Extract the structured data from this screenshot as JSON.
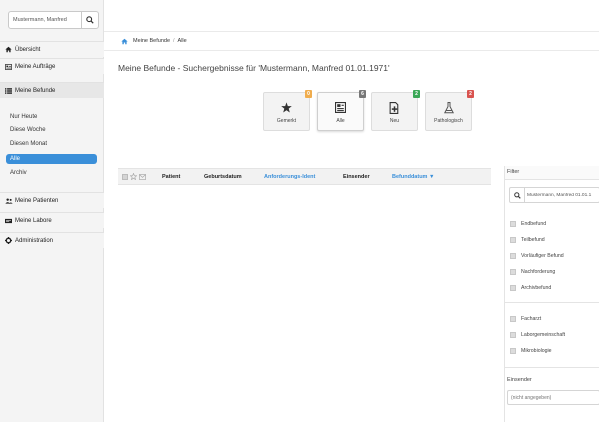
{
  "sidebar": {
    "search": {
      "value": "Mustermann, Manfred",
      "icon": "search-icon"
    },
    "nav": [
      {
        "label": "Übersicht",
        "icon": "home-icon"
      },
      {
        "label": "Meine Aufträge",
        "icon": "orders-icon"
      },
      {
        "label": "Meine Befunde",
        "icon": "list-icon"
      }
    ],
    "sub_items": [
      {
        "label": "Nur Heute"
      },
      {
        "label": "Diese Woche"
      },
      {
        "label": "Diesen Monat"
      },
      {
        "label": "Alle",
        "selected": true
      },
      {
        "label": "Archiv"
      }
    ],
    "nav_bottom": [
      {
        "label": "Meine Patienten",
        "icon": "patients-icon"
      },
      {
        "label": "Meine Labore",
        "icon": "labs-icon"
      },
      {
        "label": "Administration",
        "icon": "gear-icon"
      }
    ]
  },
  "breadcrumb": {
    "home_icon": "home-icon",
    "items": [
      "Meine Befunde",
      "/",
      "Alle"
    ]
  },
  "page_title": "Meine Befunde - Suchergebnisse für 'Mustermann, Manfred 01.01.1971'",
  "tiles": [
    {
      "label": "Gemerkt",
      "icon": "star-icon",
      "badge": "0",
      "badge_color": "#f0ad4e"
    },
    {
      "label": "Alle",
      "icon": "document-icon",
      "badge": "6",
      "badge_color": "#777777",
      "selected": true
    },
    {
      "label": "Neu",
      "icon": "new-document-icon",
      "badge": "2",
      "badge_color": "#3aa757"
    },
    {
      "label": "Pathologisch",
      "icon": "flask-icon",
      "badge": "2",
      "badge_color": "#d9534f"
    }
  ],
  "table": {
    "columns": [
      "Patient",
      "Geburtsdatum",
      "Anforderungs-Ident",
      "Einsender",
      "Befunddatum ▼"
    ],
    "link_color": "#3a8fd9"
  },
  "filter": {
    "title": "Filter",
    "search_value": "Mustermann, Manfred 01.01.1",
    "status": [
      "Endbefund",
      "Teilbefund",
      "Vorläufiger Befund",
      "Nachforderung",
      "Archivbefund"
    ],
    "type": [
      "Facharzt",
      "Laborgemeinschaft",
      "Mikrobiologie"
    ],
    "sender_label": "Einsender",
    "sender_placeholder": "(nicht angegeben)"
  }
}
